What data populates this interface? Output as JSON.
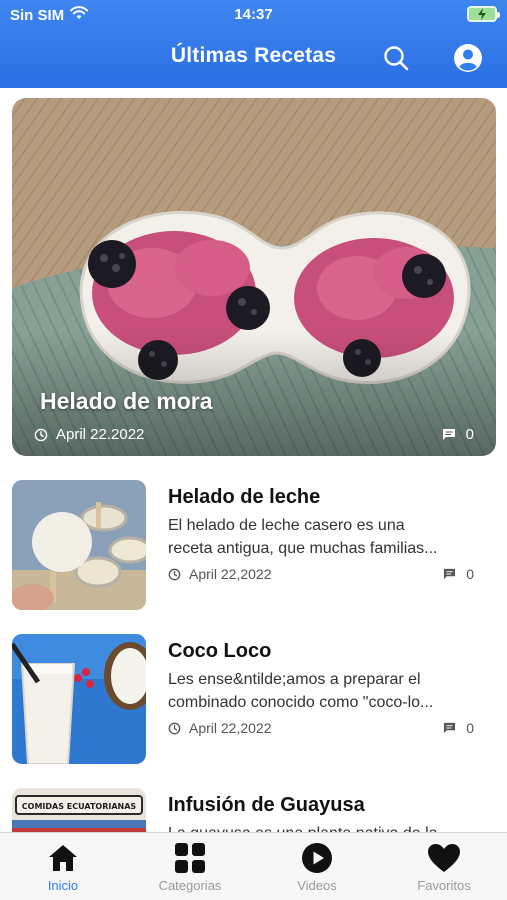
{
  "status_bar": {
    "carrier": "Sin SIM",
    "time": "14:37"
  },
  "header": {
    "title": "Últimas Recetas",
    "search_icon": "search-icon",
    "profile_icon": "user-circle-icon"
  },
  "featured": {
    "title": "Helado de mora",
    "date": "April 22.2022",
    "comments": "0"
  },
  "recipes": [
    {
      "title": "Helado de leche",
      "desc_line1": "El helado de leche casero es una",
      "desc_line2": "receta antigua, que muchas familias...",
      "date": "April 22,2022",
      "comments": "0"
    },
    {
      "title": "Coco Loco",
      "desc_line1": "Les ense&ntilde;amos a preparar el",
      "desc_line2": "combinado conocido como \"coco-lo...",
      "date": "April 22,2022",
      "comments": "0"
    },
    {
      "title": "Infusión de Guayusa",
      "desc_line1": "La guayusa es una planta nativa de la",
      "desc_line2": "",
      "date": "",
      "comments": "",
      "thumb_banner": "COMIDAS ECUATORIANAS"
    }
  ],
  "tabs": [
    {
      "label": "Inicio",
      "icon": "home-icon",
      "active": true
    },
    {
      "label": "Categorias",
      "icon": "grid-icon",
      "active": false
    },
    {
      "label": "Videos",
      "icon": "play-circle-icon",
      "active": false
    },
    {
      "label": "Favoritos",
      "icon": "heart-icon",
      "active": false
    }
  ],
  "colors": {
    "header": "#2f7ef0",
    "active_tab": "#2f7ef0",
    "inactive_tab": "#9a9a9a"
  }
}
